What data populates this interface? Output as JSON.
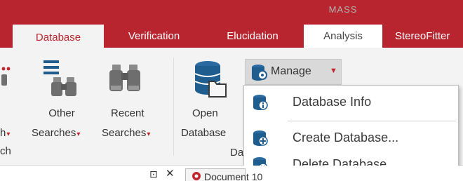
{
  "header": {
    "mass_label": "MASS"
  },
  "tabs": [
    {
      "label": "Database"
    },
    {
      "label": "Verification"
    },
    {
      "label": "Elucidation"
    },
    {
      "label": "Analysis"
    },
    {
      "label": "StereoFitter"
    }
  ],
  "ribbon": {
    "partial_left_top": "h",
    "partial_left_bottom": "ch",
    "other_searches": {
      "line1": "Other",
      "line2": "Searches"
    },
    "recent_searches": {
      "line1": "Recent",
      "line2": "Searches"
    },
    "open_database": {
      "line1": "Open",
      "line2": "Database"
    },
    "group_label_partial": "Da",
    "manage": {
      "label": "Manage"
    }
  },
  "manage_menu": {
    "items": [
      {
        "label": "Database Info",
        "icon": "database-info-icon"
      },
      {
        "label": "Create Database...",
        "icon": "create-database-icon"
      },
      {
        "label": "Delete Database...",
        "icon": "delete-database-icon"
      }
    ]
  },
  "document_area": {
    "pin_icon": "pin-icon",
    "close_icon": "close-icon",
    "doc_tab_label": "Document 10"
  },
  "colors": {
    "brand_red": "#b8252e",
    "ribbon_bg": "#f3f3f3",
    "icon_blue": "#1f5d8f"
  }
}
